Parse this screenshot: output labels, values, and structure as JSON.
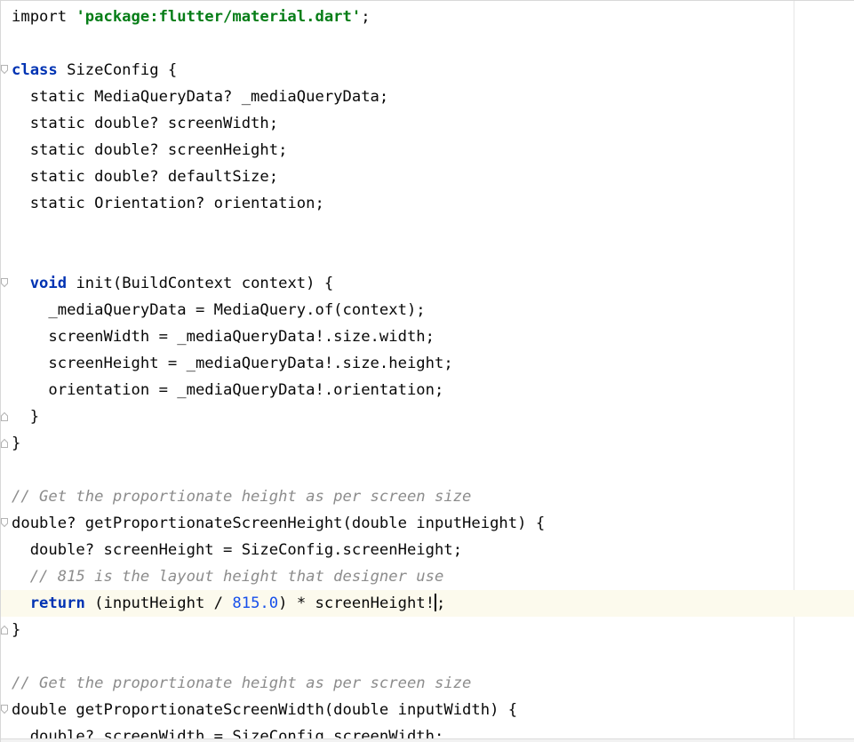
{
  "editor": {
    "lines": [
      {
        "fold": "",
        "current": false,
        "tokens": [
          {
            "t": "import ",
            "c": "plain"
          },
          {
            "t": "'package:flutter/material.dart'",
            "c": "str"
          },
          {
            "t": ";",
            "c": "plain"
          }
        ]
      },
      {
        "fold": "",
        "current": false,
        "tokens": []
      },
      {
        "fold": "open",
        "current": false,
        "tokens": [
          {
            "t": "class",
            "c": "kw"
          },
          {
            "t": " SizeConfig {",
            "c": "plain"
          }
        ]
      },
      {
        "fold": "",
        "current": false,
        "tokens": [
          {
            "t": "  static MediaQueryData? _mediaQueryData;",
            "c": "plain"
          }
        ]
      },
      {
        "fold": "",
        "current": false,
        "tokens": [
          {
            "t": "  static double? screenWidth;",
            "c": "plain"
          }
        ]
      },
      {
        "fold": "",
        "current": false,
        "tokens": [
          {
            "t": "  static double? screenHeight;",
            "c": "plain"
          }
        ]
      },
      {
        "fold": "",
        "current": false,
        "tokens": [
          {
            "t": "  static double? defaultSize;",
            "c": "plain"
          }
        ]
      },
      {
        "fold": "",
        "current": false,
        "tokens": [
          {
            "t": "  static Orientation? orientation;",
            "c": "plain"
          }
        ]
      },
      {
        "fold": "",
        "current": false,
        "tokens": []
      },
      {
        "fold": "",
        "current": false,
        "tokens": []
      },
      {
        "fold": "open",
        "current": false,
        "tokens": [
          {
            "t": "  ",
            "c": "plain"
          },
          {
            "t": "void",
            "c": "kw"
          },
          {
            "t": " init(BuildContext context) {",
            "c": "plain"
          }
        ]
      },
      {
        "fold": "",
        "current": false,
        "tokens": [
          {
            "t": "    _mediaQueryData = MediaQuery.of(context);",
            "c": "plain"
          }
        ]
      },
      {
        "fold": "",
        "current": false,
        "tokens": [
          {
            "t": "    screenWidth = _mediaQueryData!.size.width;",
            "c": "plain"
          }
        ]
      },
      {
        "fold": "",
        "current": false,
        "tokens": [
          {
            "t": "    screenHeight = _mediaQueryData!.size.height;",
            "c": "plain"
          }
        ]
      },
      {
        "fold": "",
        "current": false,
        "tokens": [
          {
            "t": "    orientation = _mediaQueryData!.orientation;",
            "c": "plain"
          }
        ]
      },
      {
        "fold": "close",
        "current": false,
        "tokens": [
          {
            "t": "  }",
            "c": "plain"
          }
        ]
      },
      {
        "fold": "close",
        "current": false,
        "tokens": [
          {
            "t": "}",
            "c": "plain"
          }
        ]
      },
      {
        "fold": "",
        "current": false,
        "tokens": []
      },
      {
        "fold": "",
        "current": false,
        "tokens": [
          {
            "t": "// Get the proportionate height as per screen size",
            "c": "cmt"
          }
        ]
      },
      {
        "fold": "open",
        "current": false,
        "tokens": [
          {
            "t": "double? getProportionateScreenHeight(double inputHeight) {",
            "c": "plain"
          }
        ]
      },
      {
        "fold": "",
        "current": false,
        "tokens": [
          {
            "t": "  double? screenHeight = SizeConfig.screenHeight;",
            "c": "plain"
          }
        ]
      },
      {
        "fold": "",
        "current": false,
        "tokens": [
          {
            "t": "  ",
            "c": "plain"
          },
          {
            "t": "// 815 is the layout height that designer use",
            "c": "cmt"
          }
        ]
      },
      {
        "fold": "",
        "current": true,
        "tokens": [
          {
            "t": "  ",
            "c": "plain"
          },
          {
            "t": "return",
            "c": "kw"
          },
          {
            "t": " (inputHeight / ",
            "c": "plain"
          },
          {
            "t": "815.0",
            "c": "num"
          },
          {
            "t": ") * screenHeight!",
            "c": "plain"
          },
          {
            "t": "",
            "c": "caret"
          },
          {
            "t": ";",
            "c": "plain"
          }
        ]
      },
      {
        "fold": "close",
        "current": false,
        "tokens": [
          {
            "t": "}",
            "c": "plain"
          }
        ]
      },
      {
        "fold": "",
        "current": false,
        "tokens": []
      },
      {
        "fold": "",
        "current": false,
        "tokens": [
          {
            "t": "// Get the proportionate height as per screen size",
            "c": "cmt"
          }
        ]
      },
      {
        "fold": "open",
        "current": false,
        "tokens": [
          {
            "t": "double getProportionateScreenWidth(double inputWidth) {",
            "c": "plain"
          }
        ]
      },
      {
        "fold": "",
        "current": false,
        "tokens": [
          {
            "t": "  double? screenWidth = SizeConfig.screenWidth;",
            "c": "plain"
          }
        ]
      }
    ]
  }
}
